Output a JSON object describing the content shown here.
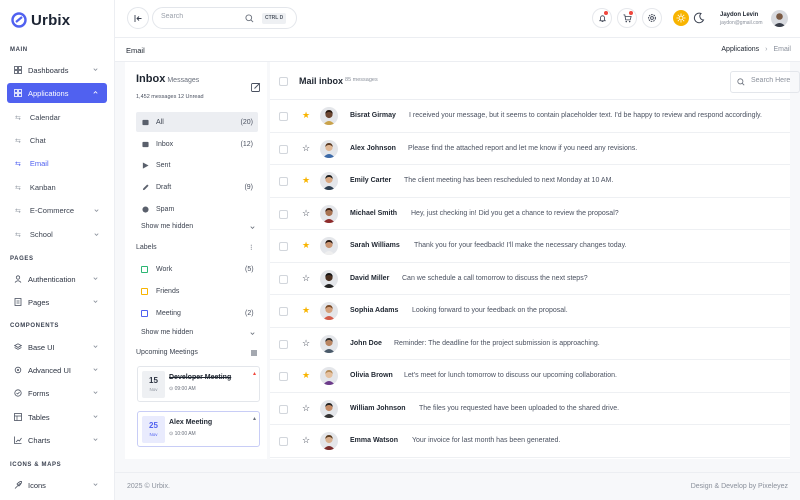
{
  "app": {
    "name": "Urbix"
  },
  "sidebar": {
    "sections": {
      "main": "MAIN",
      "pages": "PAGES",
      "components": "COMPONENTS",
      "icons_maps": "ICONS & MAPS"
    },
    "items": {
      "dashboards": "Dashboards",
      "applications": "Applications",
      "calendar": "Calendar",
      "chat": "Chat",
      "email": "Email",
      "kanban": "Kanban",
      "ecommerce": "E-Commerce",
      "school": "School",
      "authentication": "Authentication",
      "pages": "Pages",
      "base_ui": "Base UI",
      "advanced_ui": "Advanced UI",
      "forms": "Forms",
      "tables": "Tables",
      "charts": "Charts",
      "icons": "Icons"
    }
  },
  "topbar": {
    "search_placeholder": "Search",
    "search_shortcut": "CTRL D",
    "user": {
      "name": "Jaydon Levin",
      "email": "jaydon@gmail.com"
    }
  },
  "breadcrumb": {
    "title": "Email",
    "items": [
      "Applications",
      "Email"
    ]
  },
  "inbox": {
    "title": "Inbox",
    "subtitle": "Messages",
    "counts": "1,452 messages 12 Unread",
    "folders": [
      {
        "name": "All",
        "count": "(20)",
        "icon": "inbox-icon"
      },
      {
        "name": "Inbox",
        "count": "(12)",
        "icon": "inbox-tray-icon"
      },
      {
        "name": "Sent",
        "count": "",
        "icon": "send-icon"
      },
      {
        "name": "Draft",
        "count": "(9)",
        "icon": "pencil-icon"
      },
      {
        "name": "Spam",
        "count": "",
        "icon": "spam-icon"
      }
    ],
    "show_more": "Show me hidden",
    "labels_title": "Labels",
    "labels": [
      {
        "name": "Work",
        "count": "(5)",
        "color": "#2bb673"
      },
      {
        "name": "Friends",
        "count": "",
        "color": "#f8b400"
      },
      {
        "name": "Meeting",
        "count": "(2)",
        "color": "#5061f0"
      }
    ],
    "upcoming_title": "Upcoming Meetings",
    "meetings": [
      {
        "day": "15",
        "month": "Nov",
        "title": "Developer Meeting",
        "time": "09:00 AM",
        "done": true
      },
      {
        "day": "25",
        "month": "Nov",
        "title": "Alex Meeting",
        "time": "10:00 AM",
        "done": false
      }
    ]
  },
  "mail": {
    "title": "Mail inbox",
    "count": "85 messages",
    "search_placeholder": "Search Here",
    "messages": [
      {
        "name": "Bisrat Girmay",
        "preview": "I received your message, but it seems to contain placeholder text. I'd be happy to review and respond accordingly.",
        "starred": true
      },
      {
        "name": "Alex Johnson",
        "preview": "Please find the attached report and let me know if you need any revisions.",
        "starred": false
      },
      {
        "name": "Emily Carter",
        "preview": "The client meeting has been rescheduled to next Monday at 10 AM.",
        "starred": true
      },
      {
        "name": "Michael Smith",
        "preview": "Hey, just checking in! Did you get a chance to review the proposal?",
        "starred": false
      },
      {
        "name": "Sarah Williams",
        "preview": "Thank you for your feedback! I'll make the necessary changes today.",
        "starred": true
      },
      {
        "name": "David Miller",
        "preview": "Can we schedule a call tomorrow to discuss the next steps?",
        "starred": false
      },
      {
        "name": "Sophia Adams",
        "preview": "Looking forward to your feedback on the proposal.",
        "starred": true
      },
      {
        "name": "John Doe",
        "preview": "Reminder: The deadline for the project submission is approaching.",
        "starred": false
      },
      {
        "name": "Olivia Brown",
        "preview": "Let's meet for lunch tomorrow to discuss our upcoming collaboration.",
        "starred": true
      },
      {
        "name": "William Johnson",
        "preview": "The files you requested have been uploaded to the shared drive.",
        "starred": false
      },
      {
        "name": "Emma Watson",
        "preview": "Your invoice for last month has been generated.",
        "starred": false
      }
    ]
  },
  "footer": {
    "copyright": "2025 © Urbix.",
    "credit": "Design & Develop by Pixeleyez"
  },
  "colors": {
    "accent": "#5061f0",
    "star": "#f8b400",
    "badge": "#f0483e"
  }
}
